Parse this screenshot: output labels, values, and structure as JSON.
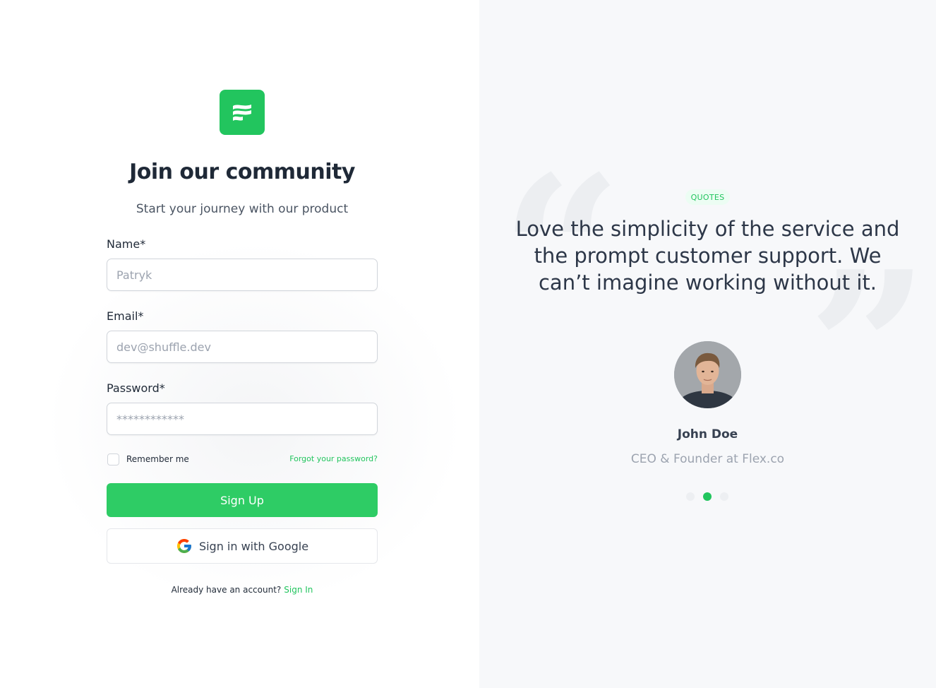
{
  "form": {
    "title": "Join our community",
    "subtitle": "Start your journey with our product",
    "name_label": "Name*",
    "name_placeholder": "Patryk",
    "email_label": "Email*",
    "email_placeholder": "dev@shuffle.dev",
    "password_label": "Password*",
    "password_placeholder": "************",
    "remember_label": "Remember me",
    "forgot_link": "Forgot your password?",
    "signup_button": "Sign Up",
    "google_button": "Sign in with Google",
    "already_text": "Already have an account?",
    "signin_link": "Sign In"
  },
  "testimonial": {
    "badge": "QUOTES",
    "quote": "Love the simplicity of the service and the prompt customer support. We can’t imagine working without it.",
    "author_name": "John Doe",
    "author_role": "CEO & Founder at Flex.co",
    "active_slide": 2,
    "slide_count": 3
  },
  "colors": {
    "accent": "#2ecc65",
    "right_panel_bg": "#f7f8fa"
  },
  "icons": {
    "logo": "shuffle-logo-icon",
    "google": "google-icon",
    "avatar": "avatar-photo"
  }
}
